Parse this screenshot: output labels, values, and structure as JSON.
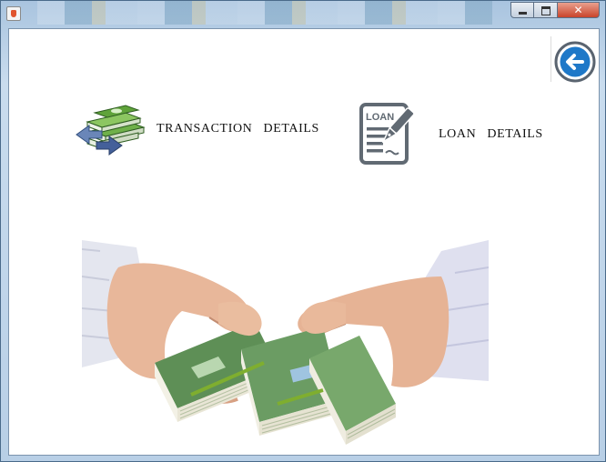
{
  "window": {
    "app_icon": "java-cup-icon",
    "close_glyph": "✕"
  },
  "toolbar": {
    "back_icon": "back-arrow-icon",
    "accent_color": "#1e78c8"
  },
  "nav": {
    "transaction": {
      "icon": "money-transfer-icon",
      "label": "TRANSACTION DETAILS"
    },
    "loan": {
      "icon": "loan-document-icon",
      "icon_text": "LOAN",
      "label": "LOAN DETAILS"
    }
  },
  "hero": {
    "image": "hands-holding-money-image"
  }
}
